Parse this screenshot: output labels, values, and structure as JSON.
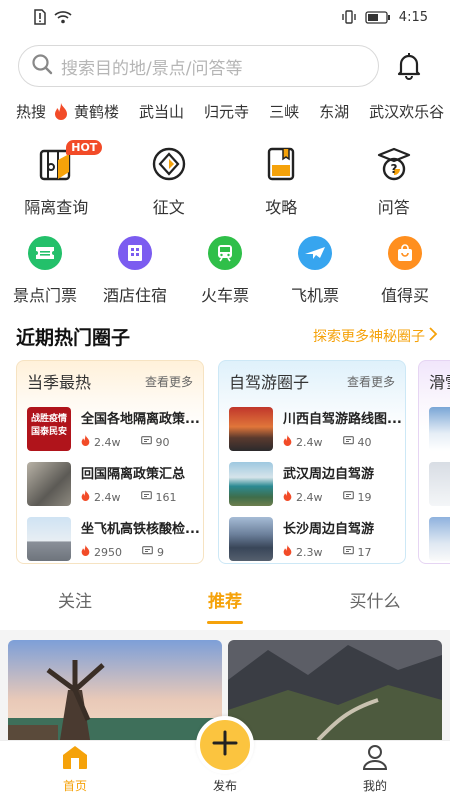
{
  "status_bar": {
    "time": "4:15"
  },
  "search": {
    "placeholder": "搜索目的地/景点/问答等"
  },
  "hot_search": {
    "label": "热搜",
    "tags": [
      "黄鹤楼",
      "武当山",
      "归元寺",
      "三峡",
      "东湖",
      "武汉欢乐谷"
    ]
  },
  "quick_grid": [
    {
      "label": "隔离查询",
      "badge": "HOT",
      "icon": "isolation-map-icon"
    },
    {
      "label": "征文",
      "icon": "essay-diamond-icon"
    },
    {
      "label": "攻略",
      "icon": "guide-book-icon"
    },
    {
      "label": "问答",
      "icon": "qa-question-icon"
    }
  ],
  "service_grid": [
    {
      "label": "景点门票",
      "icon": "ticket-icon",
      "color": "#23c06a"
    },
    {
      "label": "酒店住宿",
      "icon": "hotel-icon",
      "color": "#7b5cf0"
    },
    {
      "label": "火车票",
      "icon": "train-icon",
      "color": "#2fbf49"
    },
    {
      "label": "飞机票",
      "icon": "plane-icon",
      "color": "#37a5ef"
    },
    {
      "label": "值得买",
      "icon": "shopping-bag-icon",
      "color": "#ff8f1f"
    }
  ],
  "circles": {
    "title": "近期热门圈子",
    "more": "探索更多神秘圈子",
    "cards": [
      {
        "title": "当季最热",
        "more": "查看更多",
        "items": [
          {
            "title": "全国各地隔离政策...",
            "hot": "2.4w",
            "comments": "90",
            "thumb_text": [
              "战胜疫情",
              "国泰民安"
            ]
          },
          {
            "title": "回国隔离政策汇总",
            "hot": "2.4w",
            "comments": "161"
          },
          {
            "title": "坐飞机高铁核酸检...",
            "hot": "2950",
            "comments": "9"
          }
        ]
      },
      {
        "title": "自驾游圈子",
        "more": "查看更多",
        "items": [
          {
            "title": "川西自驾游路线图...",
            "hot": "2.4w",
            "comments": "40"
          },
          {
            "title": "武汉周边自驾游",
            "hot": "2.4w",
            "comments": "19"
          },
          {
            "title": "长沙周边自驾游",
            "hot": "2.3w",
            "comments": "17"
          }
        ]
      },
      {
        "title": "滑雪"
      }
    ]
  },
  "feed_tabs": [
    "关注",
    "推荐",
    "买什么"
  ],
  "bottom_nav": {
    "home": "首页",
    "publish": "发布",
    "mine": "我的"
  },
  "colors": {
    "accent": "#f5a20a",
    "hot": "#f24b28"
  }
}
